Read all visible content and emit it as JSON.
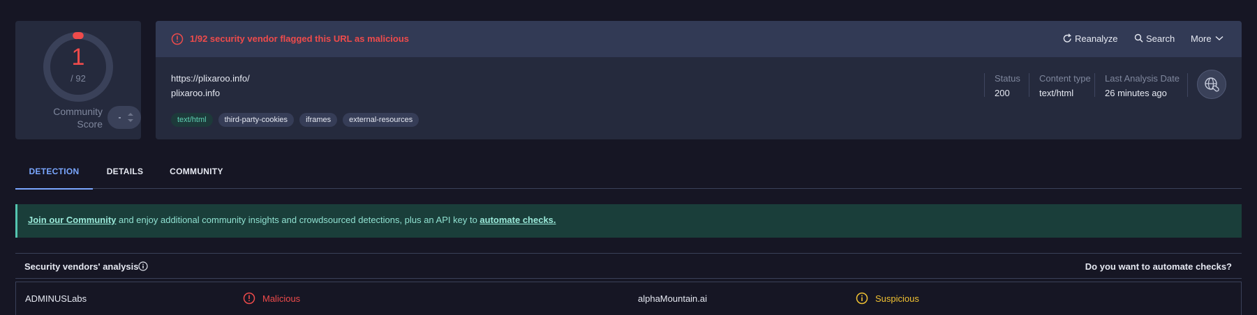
{
  "score": {
    "value": "1",
    "total": "/ 92",
    "flagged_fraction": 0.0109,
    "community_label_line1": "Community",
    "community_label_line2": "Score",
    "community_value": "-"
  },
  "alert": {
    "text": "1/92 security vendor flagged this URL as malicious",
    "color": "#ef4b4b"
  },
  "actions": {
    "reanalyze": "Reanalyze",
    "search": "Search",
    "more": "More"
  },
  "url": {
    "full": "https://plixaroo.info/",
    "domain": "plixaroo.info"
  },
  "tags": [
    "text/html",
    "third-party-cookies",
    "iframes",
    "external-resources"
  ],
  "meta": {
    "status_label": "Status",
    "status_value": "200",
    "content_type_label": "Content type",
    "content_type_value": "text/html",
    "date_label": "Last Analysis Date",
    "date_value": "26 minutes ago"
  },
  "tabs": [
    {
      "label": "DETECTION",
      "active": true
    },
    {
      "label": "DETAILS",
      "active": false
    },
    {
      "label": "COMMUNITY",
      "active": false
    }
  ],
  "banner": {
    "link1": "Join our Community",
    "middle": " and enjoy additional community insights and crowdsourced detections, plus an API key to ",
    "link2": "automate checks."
  },
  "vendors": {
    "title": "Security vendors' analysis",
    "cta": "Do you want to automate checks?",
    "rows": [
      {
        "vendor1": "ADMINUSLabs",
        "verdict1": "Malicious",
        "vendor2": "alphaMountain.ai",
        "verdict2": "Suspicious"
      }
    ]
  },
  "colors": {
    "malicious": "#ef4b4b",
    "suspicious": "#f1c232",
    "accent": "#7aa7ff",
    "banner_text": "#8fe0d0"
  }
}
